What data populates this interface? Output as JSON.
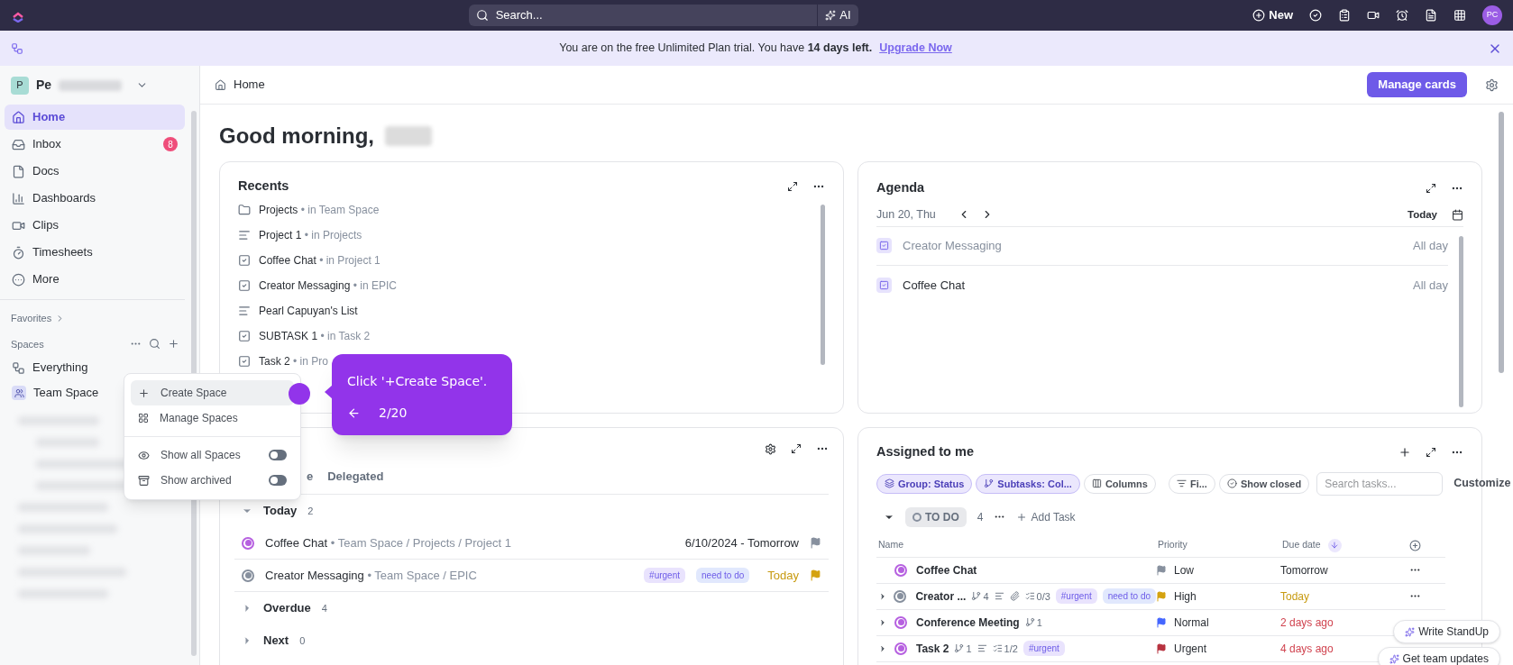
{
  "topbar": {
    "search": {
      "placeholder": "Search..."
    },
    "ai_button": "AI",
    "new_button": "New",
    "avatar": "PC"
  },
  "banner": {
    "text": "You are on the free Unlimited Plan trial. You have **14 days left.**",
    "link": "Upgrade Now"
  },
  "sidebar": {
    "workspace": {
      "initial": "P",
      "name": "Pe"
    },
    "items": [
      {
        "label": "Home",
        "kind": "home",
        "selected": true
      },
      {
        "label": "Inbox",
        "kind": "inbox",
        "selected": false,
        "badge": "8"
      },
      {
        "label": "Docs",
        "kind": "docs",
        "selected": false
      },
      {
        "label": "Dashboards",
        "kind": "dashboards",
        "selected": false
      },
      {
        "label": "Clips",
        "kind": "clips",
        "selected": false
      },
      {
        "label": "Timesheets",
        "kind": "timesheets",
        "selected": false
      },
      {
        "label": "More",
        "kind": "more",
        "selected": false
      }
    ],
    "favorites": "Favorites",
    "spaces_title": "Spaces",
    "spaces": [
      {
        "label": "Everything",
        "kind": "everything"
      },
      {
        "label": "Team Space",
        "kind": "team"
      }
    ]
  },
  "header": {
    "breadcrumb": "Home",
    "manage_button": "Manage cards"
  },
  "greeting": "Good morning,",
  "recents": {
    "title": "Recents",
    "items": [
      {
        "kind": "folder",
        "name": "Projects",
        "context": "• in Team Space"
      },
      {
        "kind": "list",
        "name": "Project 1",
        "context": "• in Projects"
      },
      {
        "kind": "task",
        "name": "Coffee Chat",
        "context": "• in Project 1"
      },
      {
        "kind": "task",
        "name": "Creator Messaging",
        "context": "• in EPIC"
      },
      {
        "kind": "list",
        "name": "Pearl Capuyan's List"
      },
      {
        "kind": "task",
        "name": "SUBTASK 1",
        "context": "• in Task 2"
      },
      {
        "kind": "task",
        "name": "Task 2",
        "context": "• in Pro"
      }
    ]
  },
  "agenda": {
    "title": "Agenda",
    "date": "Jun 20, Thu",
    "today_button": "Today",
    "items": [
      {
        "name": "Creator Messaging",
        "time": "All day",
        "dimmed": true
      },
      {
        "name": "Coffee Chat",
        "time": "All day",
        "dimmed": false
      }
    ]
  },
  "work": {
    "tabs": [
      {
        "label": "e",
        "selected": false
      },
      {
        "label": "Delegated",
        "selected": false
      }
    ],
    "groups": [
      {
        "label": "Today",
        "count": "2",
        "expanded": true,
        "tasks": [
          {
            "name": "Coffee Chat",
            "color": "#b660e0",
            "path": "• Team Space / Projects / Project 1",
            "date": {
              "text": "6/10/2024 - Tomorrow",
              "color": "#2a2e34"
            },
            "flag": {
              "color": "#87909e"
            }
          },
          {
            "name": "Creator Messaging",
            "color": "#87909e",
            "path": "• Team Space / EPIC",
            "tags": [
              {
                "label": "#urgent",
                "color": "#e9e3fd"
              },
              {
                "label": "need to do",
                "color": "#e1e8fd"
              }
            ],
            "date": {
              "text": "Today",
              "color": "#c79a10"
            },
            "flag": {
              "color": "#d4a20f"
            }
          }
        ]
      },
      {
        "label": "Overdue",
        "count": "4",
        "expanded": false
      },
      {
        "label": "Next",
        "count": "0",
        "expanded": false
      }
    ]
  },
  "assigned": {
    "title": "Assigned to me",
    "filters": [
      {
        "label": "Group: Status",
        "kind": "group",
        "active": true
      },
      {
        "label": "Subtasks: Col...",
        "kind": "subtasks",
        "active": true
      },
      {
        "label": "Columns",
        "kind": "columns",
        "active": false
      },
      {
        "label": "Fi...",
        "kind": "filter",
        "active": false
      },
      {
        "label": "Show closed",
        "kind": "closed",
        "active": false
      }
    ],
    "search": {
      "placeholder": "Search tasks..."
    },
    "customize": "Customize",
    "status_group": {
      "label": "TO DO",
      "count": "4",
      "add": "Add Task",
      "expanded": true
    },
    "columns": [
      "Name",
      "Priority",
      "Due date"
    ],
    "rows": [
      {
        "name": "Coffee Chat",
        "color": "#b660e0",
        "expandable": false,
        "flag": {
          "color": "#87909e"
        },
        "priority": "Low",
        "due": {
          "text": "Tomorrow",
          "color": "#2a2e34"
        },
        "more": true
      },
      {
        "name": "Creator ...",
        "color": "#87909e",
        "expandable": true,
        "meta": [
          {
            "kind": "subtasks",
            "text": "4"
          },
          {
            "kind": "description"
          },
          {
            "kind": "attachment"
          },
          {
            "kind": "checklist",
            "text": "0/3"
          }
        ],
        "tags": [
          {
            "label": "#urgent",
            "color": "#e9e3fd"
          },
          {
            "label": "need to do",
            "color": "#e1e8fd"
          }
        ],
        "flag": {
          "color": "#d4a20f"
        },
        "priority": "High",
        "due": {
          "text": "Today",
          "color": "#c79a10"
        },
        "more": true
      },
      {
        "name": "Conference Meeting",
        "color": "#b660e0",
        "expandable": true,
        "meta": [
          {
            "kind": "subtasks",
            "text": "1"
          }
        ],
        "flag": {
          "color": "#4466ff"
        },
        "priority": "Normal",
        "due": {
          "text": "2 days ago",
          "color": "#d0434f"
        },
        "more": false
      },
      {
        "name": "Task 2",
        "color": "#b660e0",
        "expandable": true,
        "meta": [
          {
            "kind": "subtasks",
            "text": "1"
          },
          {
            "kind": "description"
          },
          {
            "kind": "checklist",
            "text": "1/2"
          }
        ],
        "tags": [
          {
            "label": "#urgent",
            "color": "#e9e3fd"
          }
        ],
        "flag": {
          "color": "#b7323f"
        },
        "priority": "Urgent",
        "due": {
          "text": "4 days ago",
          "color": "#d0434f"
        },
        "more": false
      }
    ]
  },
  "floating_buttons": [
    "Write StandUp",
    "Get team updates"
  ],
  "popup": {
    "items": [
      {
        "label": "Create Space",
        "kind": "create",
        "highlighted": true
      },
      {
        "label": "Manage Spaces",
        "kind": "manage",
        "highlighted": false
      }
    ],
    "toggles": [
      {
        "label": "Show all Spaces",
        "kind": "eye",
        "on": false
      },
      {
        "label": "Show archived",
        "kind": "archive",
        "on": false
      }
    ]
  },
  "tooltip": {
    "text": "Click '+Create Space'.",
    "step": "2/20"
  }
}
